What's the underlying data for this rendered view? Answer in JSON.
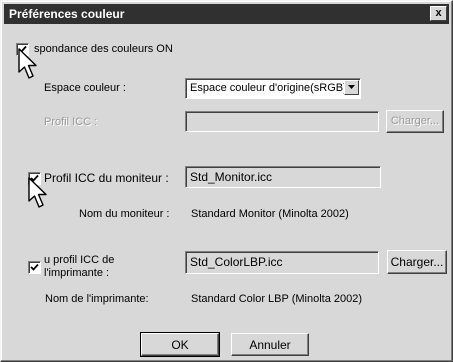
{
  "window": {
    "title": "Préférences couleur",
    "close_label": "x"
  },
  "color_matching": {
    "label": "spondance des couleurs ON",
    "checked": true
  },
  "color_space": {
    "label": "Espace couleur :",
    "selected": "Espace couleur d'origine(sRGB)"
  },
  "icc_profile": {
    "label": "Profil ICC :",
    "value": "",
    "load_button": "Charger..."
  },
  "monitor": {
    "checkbox_label": "Profil ICC du moniteur :",
    "checked": true,
    "profile_value": "Std_Monitor.icc",
    "name_label": "Nom du moniteur :",
    "name_value": "Standard Monitor (Minolta 2002)"
  },
  "printer": {
    "checkbox_label_line1": "u profil ICC de",
    "checkbox_label_line2": "l'imprimante :",
    "checked": true,
    "profile_value": "Std_ColorLBP.icc",
    "load_button": "Charger...",
    "name_label": "Nom de l'imprimante:",
    "name_value": "Standard Color LBP (Minolta 2002)"
  },
  "footer": {
    "ok_label": "OK",
    "cancel_label": "Annuler"
  }
}
